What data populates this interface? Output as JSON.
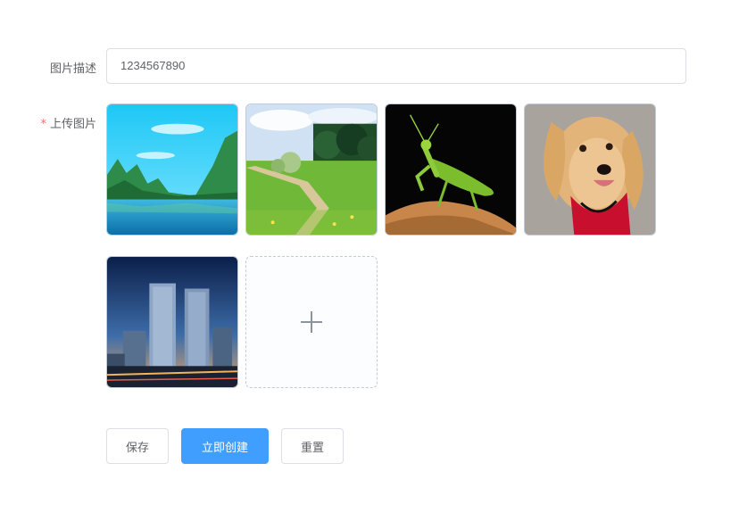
{
  "form": {
    "description_label": "图片描述",
    "description_value": "1234567890",
    "upload_label": "上传图片",
    "required_mark": "*"
  },
  "uploaded_images": [
    {
      "name": "landscape-river-icon"
    },
    {
      "name": "meadow-path-icon"
    },
    {
      "name": "mantis-icon"
    },
    {
      "name": "dog-icon"
    },
    {
      "name": "city-buildings-icon"
    }
  ],
  "add_icon": "plus-icon",
  "buttons": {
    "save": "保存",
    "create": "立即创建",
    "reset": "重置"
  },
  "colors": {
    "primary": "#409eff",
    "required": "#f56c6c",
    "border": "#dcdfe6"
  }
}
